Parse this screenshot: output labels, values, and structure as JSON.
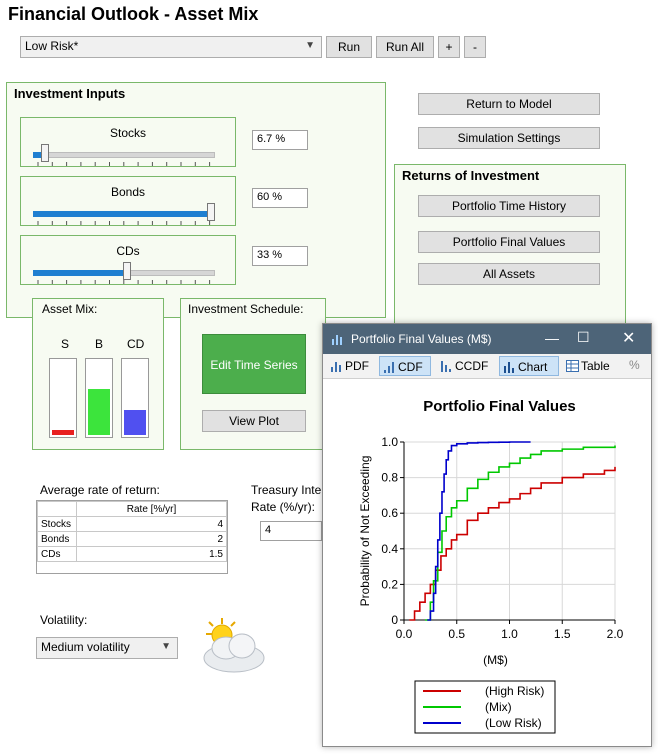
{
  "header": {
    "title": "Financial Outlook - Asset Mix"
  },
  "topbar": {
    "dropdown_value": "Low Risk*",
    "run": "Run",
    "run_all": "Run All",
    "plus": "+",
    "minus": "-"
  },
  "inputs": {
    "title": "Investment Inputs",
    "stocks": {
      "label": "Stocks",
      "value": "6.7 %",
      "fraction": 0.067
    },
    "bonds": {
      "label": "Bonds",
      "value": "60 %",
      "fraction": 0.99
    },
    "cds": {
      "label": "CDs",
      "value": "33 %",
      "fraction": 0.52
    }
  },
  "right": {
    "return_to_model": "Return to Model",
    "simulation_settings": "Simulation Settings"
  },
  "returns": {
    "title": "Returns of Investment",
    "time_history": "Portfolio Time History",
    "final_values": "Portfolio Final Values",
    "all_assets": "All Assets"
  },
  "asset_mix": {
    "title": "Asset Mix:",
    "s": "S",
    "b": "B",
    "cd": "CD",
    "s_level": 0.067,
    "b_level": 0.6,
    "cd_level": 0.33
  },
  "schedule": {
    "title": "Investment Schedule:",
    "edit": "Edit Time Series",
    "view_plot": "View Plot"
  },
  "avg_return": {
    "title": "Average rate of return:",
    "header": "Rate [%/yr]",
    "rows": [
      {
        "name": "Stocks",
        "value": "4"
      },
      {
        "name": "Bonds",
        "value": "2"
      },
      {
        "name": "CDs",
        "value": "1.5"
      }
    ]
  },
  "treasury": {
    "label_1": "Treasury Inte",
    "label_2": "Rate (%/yr):",
    "value": "4"
  },
  "volatility": {
    "label": "Volatility:",
    "value": "Medium volatility"
  },
  "window": {
    "title": "Portfolio Final Values (M$)",
    "pdf": "PDF",
    "cdf": "CDF",
    "ccdf": "CCDF",
    "chart": "Chart",
    "table": "Table",
    "percent": "%"
  },
  "chart_data": {
    "type": "line",
    "title": "Portfolio Final Values",
    "xlabel": "(M$)",
    "ylabel": "Probability of Not Exceeding",
    "xlim": [
      0,
      2
    ],
    "ylim": [
      0,
      1
    ],
    "xticks": [
      "0.0",
      "0.5",
      "1.0",
      "1.5",
      "2.0"
    ],
    "yticks": [
      "0",
      "0.2",
      "0.4",
      "0.6",
      "0.8",
      "1.0"
    ],
    "grid": true,
    "legend_position": "bottom",
    "series": [
      {
        "name": "(High Risk)",
        "color": "#cc0000",
        "x": [
          0.05,
          0.1,
          0.15,
          0.2,
          0.25,
          0.3,
          0.35,
          0.4,
          0.45,
          0.5,
          0.6,
          0.7,
          0.8,
          0.9,
          1.0,
          1.1,
          1.2,
          1.3,
          1.5,
          1.7,
          1.9,
          2.0
        ],
        "y": [
          0.0,
          0.05,
          0.1,
          0.15,
          0.2,
          0.28,
          0.36,
          0.4,
          0.45,
          0.48,
          0.56,
          0.6,
          0.63,
          0.66,
          0.68,
          0.71,
          0.74,
          0.77,
          0.8,
          0.82,
          0.84,
          0.86
        ]
      },
      {
        "name": "(Mix)",
        "color": "#00c800",
        "x": [
          0.2,
          0.25,
          0.28,
          0.32,
          0.36,
          0.4,
          0.45,
          0.5,
          0.6,
          0.7,
          0.8,
          0.9,
          1.0,
          1.1,
          1.2,
          1.3,
          1.5,
          1.7,
          1.9,
          2.0
        ],
        "y": [
          0.0,
          0.1,
          0.22,
          0.38,
          0.5,
          0.58,
          0.63,
          0.67,
          0.74,
          0.79,
          0.83,
          0.86,
          0.88,
          0.91,
          0.93,
          0.95,
          0.96,
          0.97,
          0.97,
          0.98
        ]
      },
      {
        "name": "(Low Risk)",
        "color": "#0000cc",
        "x": [
          0.22,
          0.25,
          0.28,
          0.3,
          0.32,
          0.34,
          0.36,
          0.38,
          0.4,
          0.42,
          0.45,
          0.5,
          0.55,
          0.6,
          0.7,
          0.8,
          0.9,
          1.0,
          1.1,
          1.2
        ],
        "y": [
          0.0,
          0.05,
          0.15,
          0.3,
          0.45,
          0.6,
          0.72,
          0.82,
          0.9,
          0.95,
          0.98,
          0.99,
          0.99,
          0.995,
          0.997,
          0.998,
          0.999,
          1.0,
          1.0,
          1.0
        ]
      }
    ]
  }
}
